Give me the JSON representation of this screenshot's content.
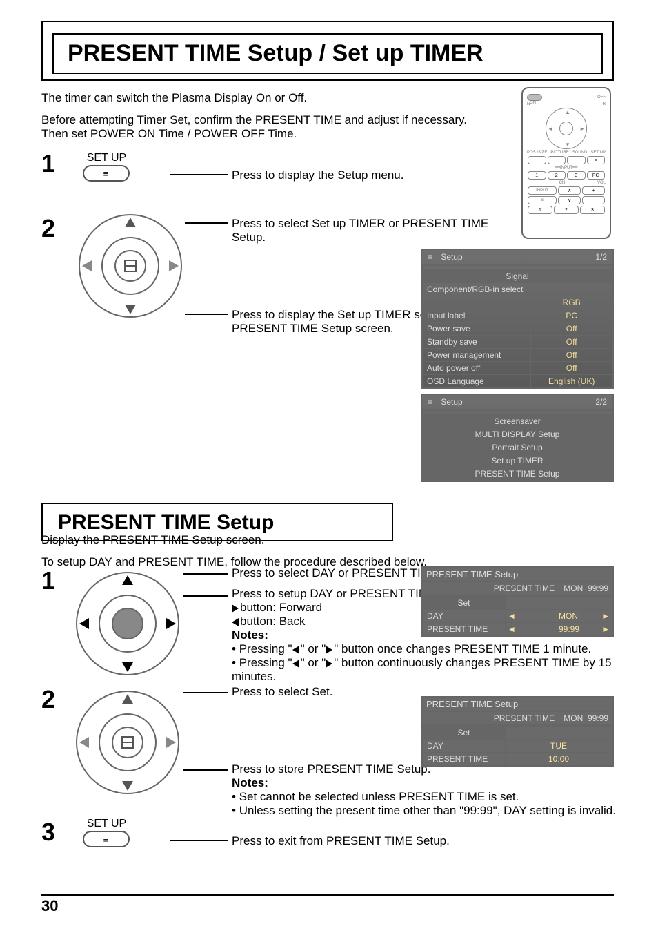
{
  "title": "PRESENT TIME Setup / Set up TIMER",
  "intro1": "The timer can switch the Plasma Display On or Off.",
  "intro2": "Before attempting Timer Set, confirm the PRESENT TIME and adjust if necessary.\nThen set POWER ON Time / POWER OFF Time.",
  "steps1": {
    "s1": {
      "num": "1",
      "label": "SET UP",
      "text": "Press to display the Setup menu."
    },
    "s2": {
      "num": "2",
      "text1": "Press to select Set up TIMER or PRESENT TIME Setup.",
      "text2": "Press to display the Set up TIMER screen or PRESENT TIME Setup screen."
    }
  },
  "osd1": {
    "title": "Setup",
    "page": "1/2",
    "rows": [
      {
        "l": "Signal",
        "sec": true
      },
      {
        "l": "Component/RGB-in select",
        "span": true
      },
      {
        "l": "",
        "v": "RGB"
      },
      {
        "l": "Input label",
        "v": "PC"
      },
      {
        "l": "Power save",
        "v": "Off"
      },
      {
        "l": "Standby save",
        "v": "Off"
      },
      {
        "l": "Power management",
        "v": "Off"
      },
      {
        "l": "Auto power off",
        "v": "Off"
      },
      {
        "l": "OSD Language",
        "v": "English (UK)"
      }
    ]
  },
  "osd2": {
    "title": "Setup",
    "page": "2/2",
    "rows": [
      {
        "l": "Screensaver",
        "sec": true
      },
      {
        "l": "MULTI DISPLAY Setup",
        "sec": true
      },
      {
        "l": "Portrait Setup",
        "sec": true
      },
      {
        "l": "Set up TIMER",
        "sec": true
      },
      {
        "l": "PRESENT TIME Setup",
        "sec": true
      }
    ]
  },
  "subtitle": "PRESENT TIME Setup",
  "subintro1": "Display the PRESENT TIME Setup screen.",
  "subintro2": "To setup DAY and PRESENT TIME, follow the procedure described below.",
  "steps2": {
    "s1": {
      "num": "1",
      "t1": "Press to select DAY or PRESENT TIME.",
      "t2": "Press to setup DAY or PRESENT TIME.",
      "b1": "button: Forward",
      "b2": "button: Back",
      "notes": "Notes:",
      "n1": "Pressing \"",
      "n1b": "\" or \"",
      "n1c": "\" button once changes PRESENT TIME 1 minute.",
      "n2": "Pressing \"",
      "n2b": "\" or \"",
      "n2c": "\" button continuously changes PRESENT TIME by 15 minutes."
    },
    "s2": {
      "num": "2",
      "t1": "Press to select Set.",
      "t2": "Press to store PRESENT TIME Setup.",
      "notes": "Notes:",
      "n1": "Set cannot be selected unless PRESENT TIME is set.",
      "n2": "Unless setting the present time other than \"99:99\", DAY setting is invalid."
    },
    "s3": {
      "num": "3",
      "label": "SET UP",
      "t": "Press to exit from PRESENT TIME Setup."
    }
  },
  "pts1": {
    "title": "PRESENT TIME Setup",
    "sub": "PRESENT TIME    MON  99:99",
    "set": "Set",
    "rows": [
      {
        "l": "DAY",
        "v": "MON"
      },
      {
        "l": "PRESENT TIME",
        "v": "99:99"
      }
    ]
  },
  "pts2": {
    "title": "PRESENT TIME Setup",
    "sub": "PRESENT TIME    MON  99:99",
    "set": "Set",
    "rows": [
      {
        "l": "DAY",
        "v": "TUE"
      },
      {
        "l": "PRESENT TIME",
        "v": "10:00"
      }
    ]
  },
  "remote": {
    "off": "OFF",
    "on": "ON",
    "n": "N",
    "r": "R",
    "pos": "POS./SIZE",
    "pic": "PICTURE",
    "snd": "SOUND",
    "setup": "SET UP",
    "input_lbl": "INPUT",
    "input": "INPUT",
    "ch": "CH",
    "vol": "VOL",
    "pc": "PC",
    "nums": [
      "1",
      "2",
      "3"
    ]
  },
  "page_num": "30"
}
